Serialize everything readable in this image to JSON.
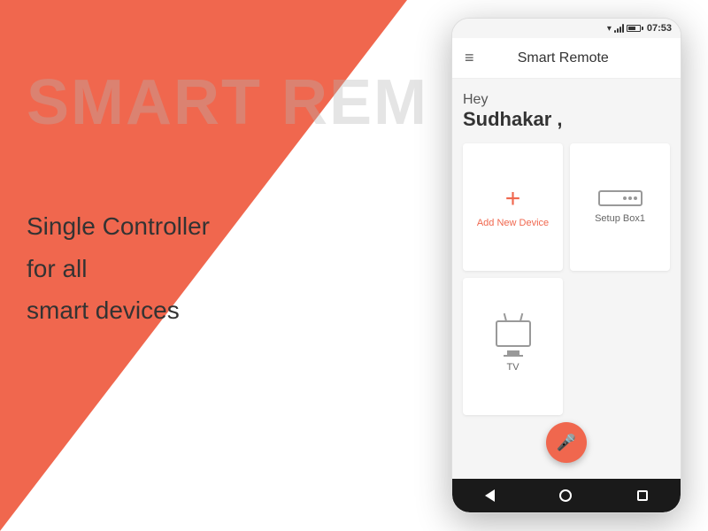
{
  "background": {
    "coral_color": "#f0674e",
    "white_color": "#ffffff"
  },
  "left": {
    "bg_title": "SMART REM",
    "tagline_lines": [
      "Single Controller",
      "for all",
      "smart devices"
    ]
  },
  "phone": {
    "status_bar": {
      "time": "07:53"
    },
    "app_bar": {
      "menu_icon": "≡",
      "title": "Smart Remote"
    },
    "greeting": {
      "hey": "Hey",
      "name": "Sudhakar ,"
    },
    "devices": [
      {
        "id": "add-new",
        "icon_type": "plus",
        "label": "Add New Device"
      },
      {
        "id": "setup-box",
        "icon_type": "setup-box",
        "label": "Setup Box1"
      },
      {
        "id": "tv",
        "icon_type": "tv",
        "label": "TV"
      }
    ],
    "fab": {
      "icon": "mic",
      "label": "Voice Control"
    },
    "nav_bar": {
      "back_label": "back",
      "home_label": "home",
      "recent_label": "recent"
    }
  }
}
